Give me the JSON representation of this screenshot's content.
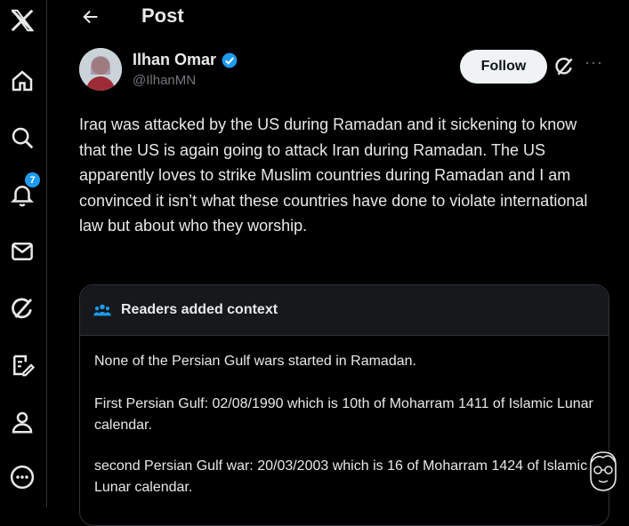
{
  "header": {
    "title": "Post"
  },
  "sidebar": {
    "items": [
      {
        "icon": "x-logo-icon"
      },
      {
        "icon": "home-icon"
      },
      {
        "icon": "search-icon"
      },
      {
        "icon": "notifications-icon",
        "badge": "7"
      },
      {
        "icon": "messages-icon"
      },
      {
        "icon": "grok-icon"
      },
      {
        "icon": "compose-icon"
      },
      {
        "icon": "profile-icon"
      },
      {
        "icon": "more-icon"
      }
    ]
  },
  "post": {
    "author_name": "Ilhan Omar",
    "handle": "@IlhanMN",
    "follow_label": "Follow",
    "more_label": "···",
    "text": "Iraq was attacked by the US during Ramadan and it sickening to know that the US is again going to attack Iran during Ramadan.  The US apparently loves to strike Muslim countries during Ramadan and I am convinced it isn’t what these countries have done to violate international law but about who they worship."
  },
  "community_note": {
    "title": "Readers added context",
    "paragraphs": [
      "None of the Persian Gulf wars started in Ramadan.",
      "First Persian Gulf: 02/08/1990 which is 10th of Moharram 1411 of Islamic Lunar calendar.",
      "second Persian Gulf war: 20/03/2003 which is 16 of Moharram 1424 of Islamic Lunar calendar."
    ]
  },
  "colors": {
    "background": "#000000",
    "text": "#e7e9ea",
    "muted": "#71767b",
    "accent": "#1d9bf0",
    "border": "#2f3336"
  }
}
